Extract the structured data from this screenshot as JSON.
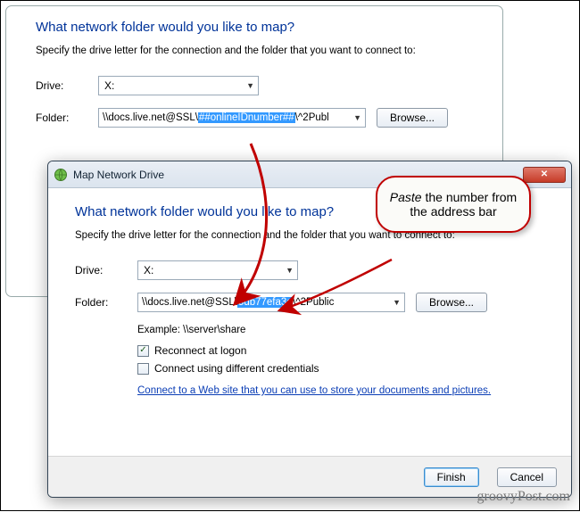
{
  "back": {
    "heading": "What network folder would you like to map?",
    "subtext": "Specify the drive letter for the connection and the folder that you want to connect to:",
    "drive_label": "Drive:",
    "drive_value": "X:",
    "folder_label": "Folder:",
    "folder_prefix": "\\\\docs.live.net@SSL\\",
    "folder_highlight": "##onlineIDnumber##",
    "folder_suffix": "\\^2Publ",
    "browse": "Browse..."
  },
  "front": {
    "title": "Map Network Drive",
    "heading": "What network folder would you like to map?",
    "subtext": "Specify the drive letter for the connection and the folder that you want to connect to:",
    "drive_label": "Drive:",
    "drive_value": "X:",
    "folder_label": "Folder:",
    "folder_prefix": "\\\\docs.live.net@SSL\\",
    "folder_highlight": "5db77efa3c",
    "folder_suffix": "\\^2Public",
    "browse": "Browse...",
    "example": "Example: \\\\server\\share",
    "reconnect": "Reconnect at logon",
    "diffcred": "Connect using different credentials",
    "link": "Connect to a Web site that you can use to store your documents and pictures.",
    "finish": "Finish",
    "cancel": "Cancel"
  },
  "callout": {
    "emph": "Paste",
    "rest": " the number from the address bar"
  },
  "watermark": "groovyPost.com"
}
